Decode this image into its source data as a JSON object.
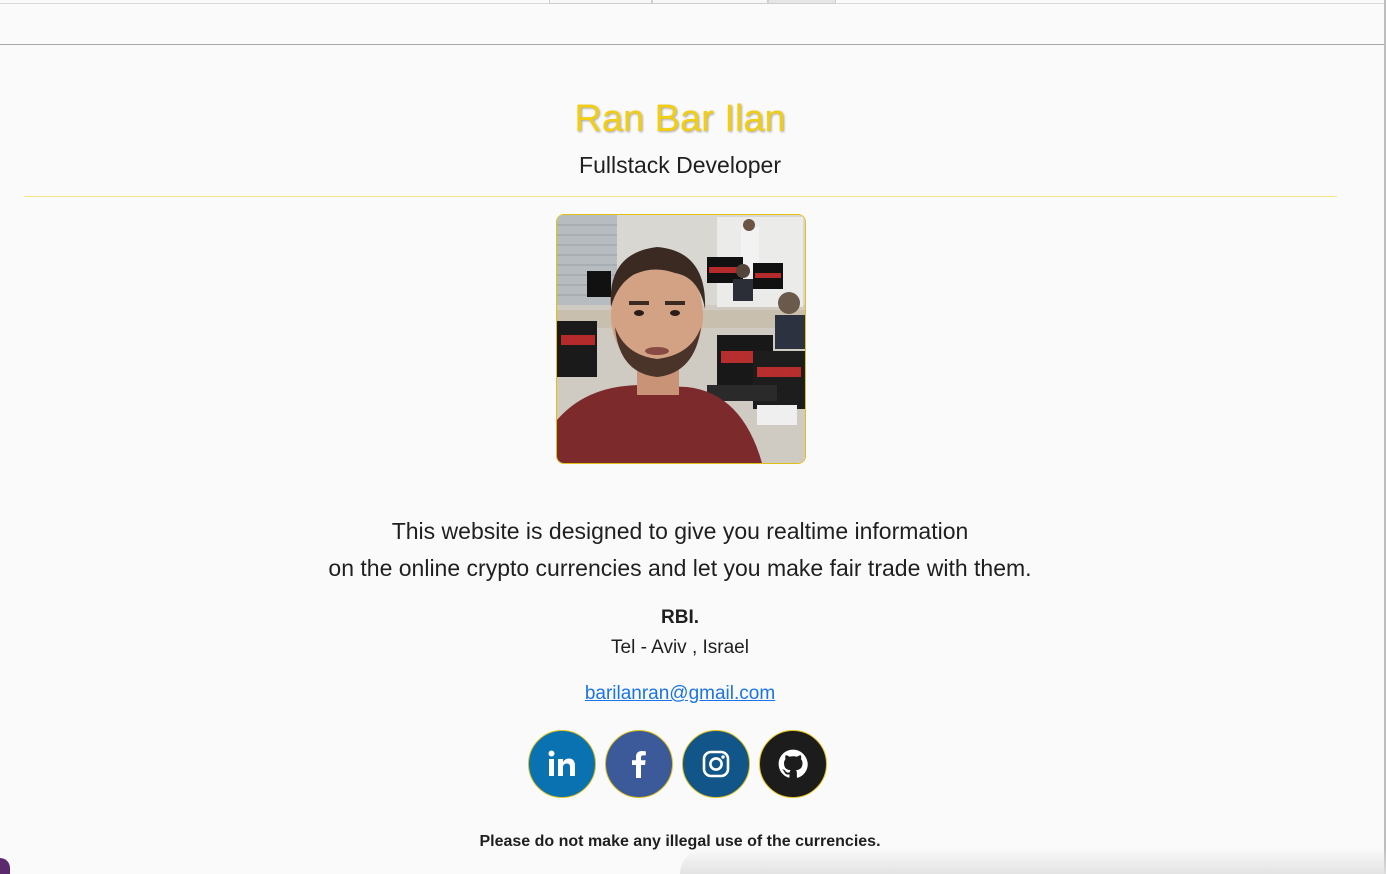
{
  "header": {
    "name": "Ran Bar Ilan",
    "role": "Fullstack Developer"
  },
  "profile_photo": {
    "alt": "Ran Bar Ilan"
  },
  "description": {
    "line1": "This website is designed to give you realtime information",
    "line2": "on the online crypto currencies and let you make fair trade with them."
  },
  "contact": {
    "signature": "RBI.",
    "location": "Tel - Aviv , Israel",
    "email": "barilanran@gmail.com"
  },
  "socials": [
    {
      "icon": "linkedin-icon",
      "color": "#0a72b1"
    },
    {
      "icon": "facebook-icon",
      "color": "#3c5a99"
    },
    {
      "icon": "instagram-icon",
      "color": "#125689"
    },
    {
      "icon": "github-icon",
      "color": "#1c1c1c"
    }
  ],
  "footer": {
    "notice": "Please do not make any illegal use of the currencies."
  },
  "colors": {
    "accent": "#f3cd10",
    "background": "#fafafa",
    "link": "#1a73e8"
  }
}
